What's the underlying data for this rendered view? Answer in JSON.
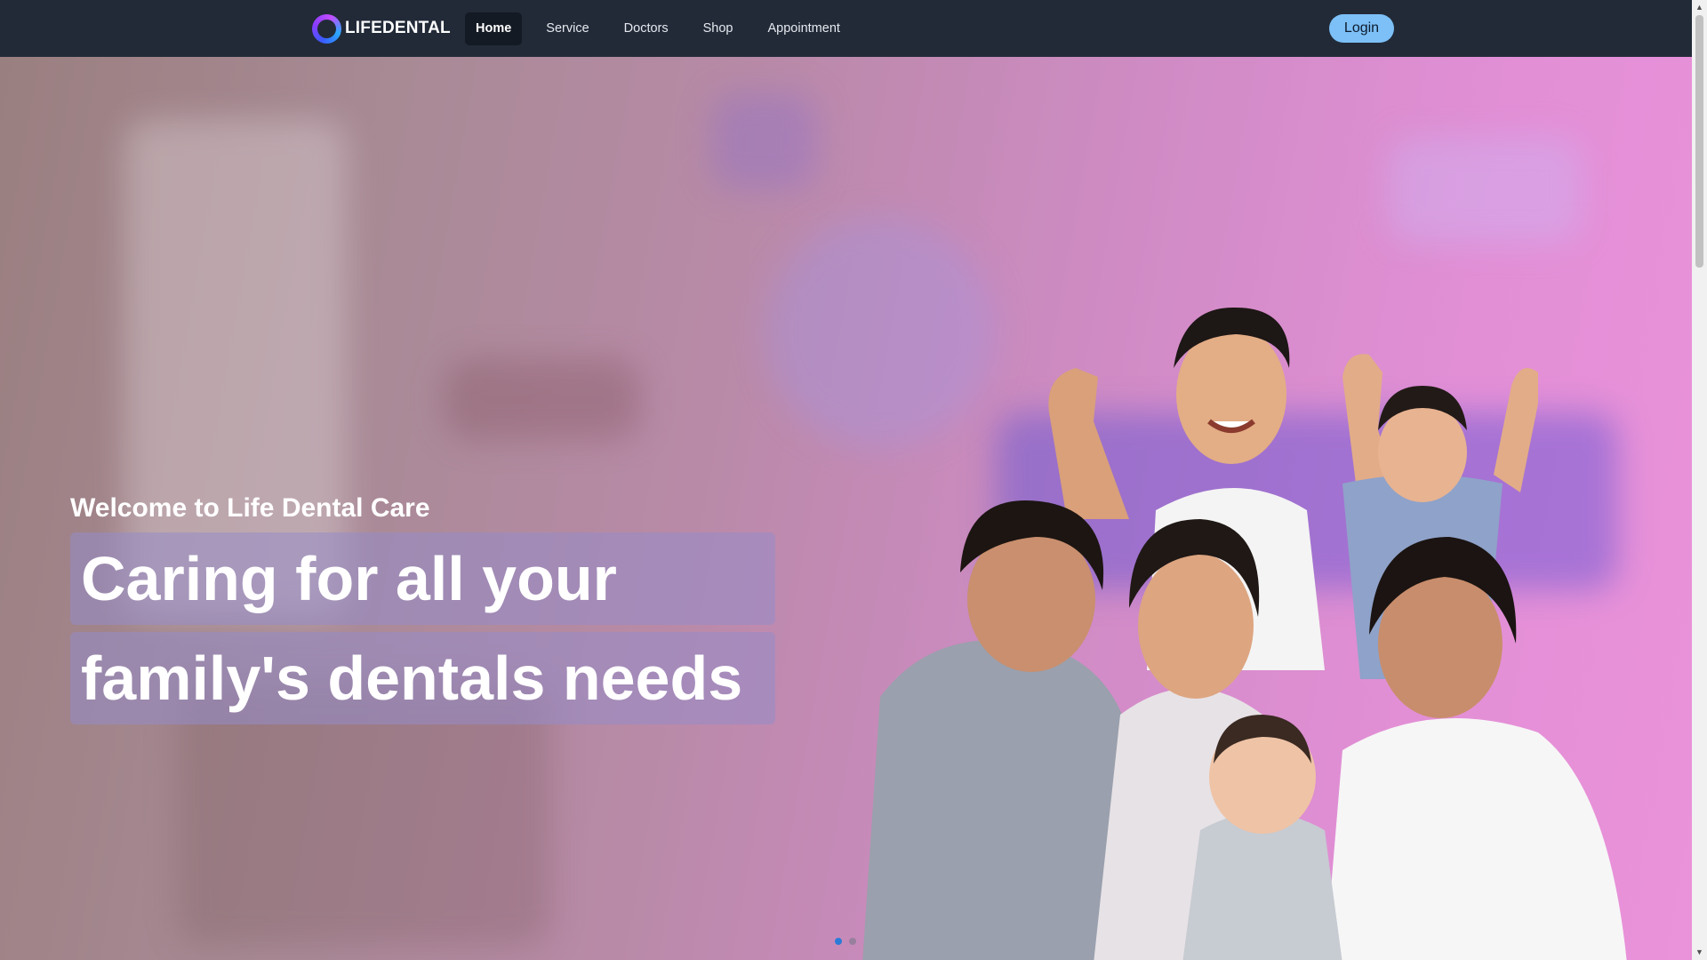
{
  "brand": {
    "name": "LIFEDENTAL",
    "ring_colors": [
      "#3a5bff",
      "#8a3cff",
      "#c44dff",
      "#2aa8ff"
    ]
  },
  "nav": {
    "items": [
      {
        "label": "Home",
        "active": true
      },
      {
        "label": "Service",
        "active": false
      },
      {
        "label": "Doctors",
        "active": false
      },
      {
        "label": "Shop",
        "active": false
      },
      {
        "label": "Appointment",
        "active": false
      }
    ],
    "login_label": "Login"
  },
  "hero": {
    "welcome": "Welcome to Life Dental Care",
    "headline_line1": "Caring for all your",
    "headline_line2": "family's dentals needs",
    "carousel": {
      "slides": 2,
      "active_index": 0
    }
  },
  "scrollbar": {
    "up_icon": "▲",
    "down_icon": "▼"
  },
  "colors": {
    "navbar_bg": "#222a38",
    "active_nav_bg": "#141a24",
    "login_button_bg": "#7cc0f7",
    "carousel_dot_active": "#2a7bd8"
  }
}
